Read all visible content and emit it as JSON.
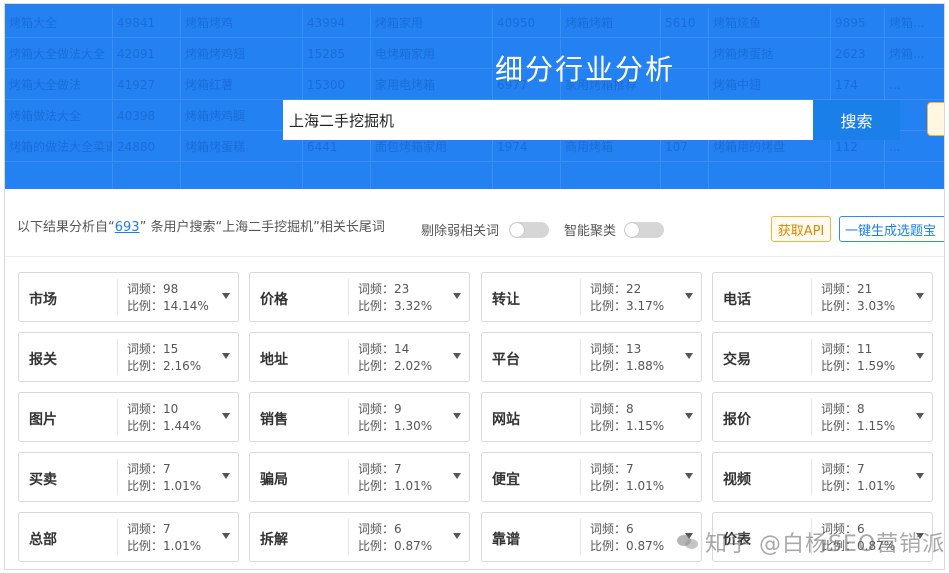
{
  "banner": {
    "title": "细分行业分析",
    "search_value": "上海二手挖掘机",
    "search_button": "搜索",
    "bg_rows": [
      [
        "烤箱大全",
        "49841",
        "烤箱烤鸡",
        "43994",
        "烤箱家用",
        "40950",
        "烤箱烤箱",
        "5610",
        "烤箱烧鱼",
        "9895",
        "烤箱..."
      ],
      [
        "烤箱大全做法大全",
        "42091",
        "烤箱烤鸡翅",
        "15285",
        "电烤箱家用",
        "",
        "",
        "",
        "烤箱烤蛋挞",
        "2623",
        "烤箱..."
      ],
      [
        "烤箱大全做法",
        "41927",
        "烤箱红薯",
        "15300",
        "家用电烤箱",
        "6977",
        "家用烤箱推荐",
        "",
        "烤箱中翅",
        "174",
        "..."
      ],
      [
        "烤箱做法大全",
        "40398",
        "烤箱烤鸡腿",
        "",
        "",
        "",
        "",
        "",
        "",
        "",
        "..."
      ],
      [
        "烤箱的做法大全菜谱",
        "24880",
        "烤箱烤蛋糕",
        "6441",
        "面包烤箱家用",
        "1974",
        "商用烤箱",
        "107",
        "烤箱用的烤盘",
        "112",
        "..."
      ],
      [
        "",
        "",
        "",
        "",
        "",
        "",
        "",
        "",
        "",
        "",
        ""
      ]
    ]
  },
  "info": {
    "prefix": "以下结果分析自“",
    "count": "693",
    "suffix": "” 条用户搜索“上海二手挖掘机”相关长尾词",
    "toggle1_label": "剔除弱相关词",
    "toggle2_label": "智能聚类",
    "api_button": "获取API",
    "gen_button": "一键生成选题宝"
  },
  "cards": [
    {
      "kw": "市场",
      "freq": "词频：98",
      "ratio": "比例：14.14%"
    },
    {
      "kw": "价格",
      "freq": "词频：23",
      "ratio": "比例：3.32%"
    },
    {
      "kw": "转让",
      "freq": "词频：22",
      "ratio": "比例：3.17%"
    },
    {
      "kw": "电话",
      "freq": "词频：21",
      "ratio": "比例：3.03%"
    },
    {
      "kw": "报关",
      "freq": "词频：15",
      "ratio": "比例：2.16%"
    },
    {
      "kw": "地址",
      "freq": "词频：14",
      "ratio": "比例：2.02%"
    },
    {
      "kw": "平台",
      "freq": "词频：13",
      "ratio": "比例：1.88%"
    },
    {
      "kw": "交易",
      "freq": "词频：11",
      "ratio": "比例：1.59%"
    },
    {
      "kw": "图片",
      "freq": "词频：10",
      "ratio": "比例：1.44%"
    },
    {
      "kw": "销售",
      "freq": "词频：9",
      "ratio": "比例：1.30%"
    },
    {
      "kw": "网站",
      "freq": "词频：8",
      "ratio": "比例：1.15%"
    },
    {
      "kw": "报价",
      "freq": "词频：8",
      "ratio": "比例：1.15%"
    },
    {
      "kw": "买卖",
      "freq": "词频：7",
      "ratio": "比例：1.01%"
    },
    {
      "kw": "骗局",
      "freq": "词频：7",
      "ratio": "比例：1.01%"
    },
    {
      "kw": "便宜",
      "freq": "词频：7",
      "ratio": "比例：1.01%"
    },
    {
      "kw": "视频",
      "freq": "词频：7",
      "ratio": "比例：1.01%"
    },
    {
      "kw": "总部",
      "freq": "词频：7",
      "ratio": "比例：1.01%"
    },
    {
      "kw": "拆解",
      "freq": "词频：6",
      "ratio": "比例：0.87%"
    },
    {
      "kw": "靠谱",
      "freq": "词频：6",
      "ratio": "比例：0.87%"
    },
    {
      "kw": "价表",
      "freq": "词频：6",
      "ratio": "比例：0.87%"
    }
  ],
  "watermark": "知乎 @白杨SEO营销派"
}
